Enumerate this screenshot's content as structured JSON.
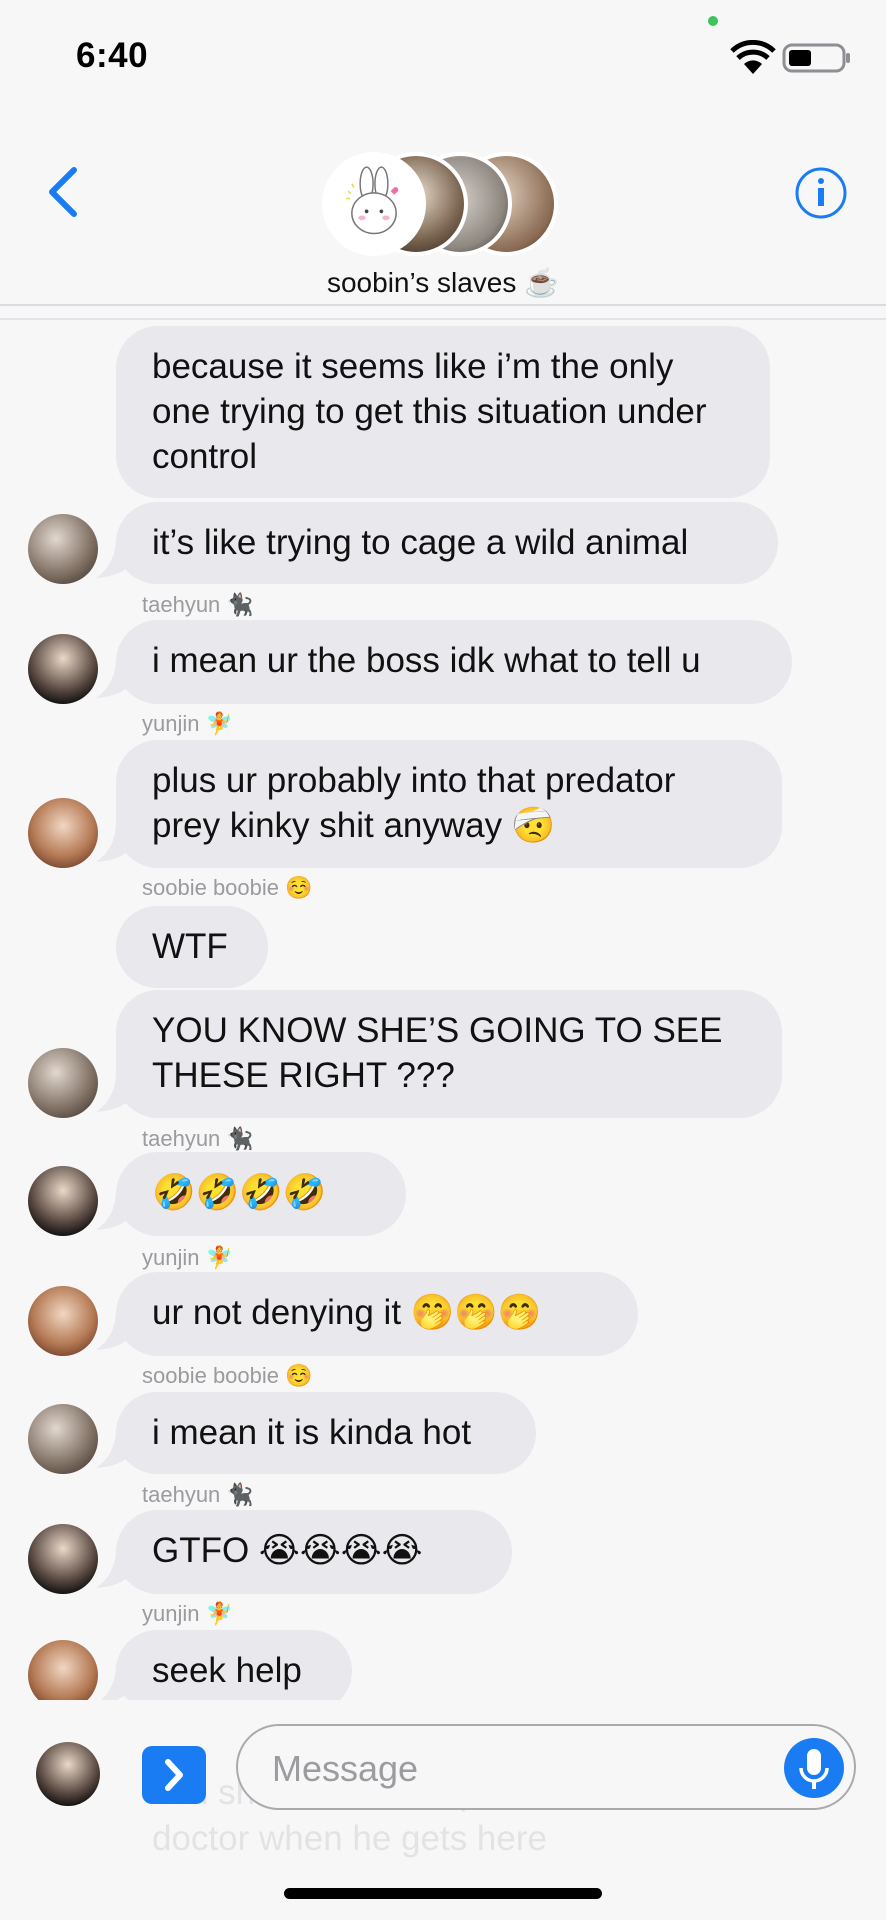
{
  "status_bar": {
    "time": "6:40"
  },
  "conversation": {
    "title": "soobin’s slaves ☕️"
  },
  "messages": [
    {
      "text": "because it seems like i’m the only one trying to get this situation under control"
    },
    {
      "text": "it’s like trying to cage a wild animal",
      "sender": "taehyun 🐈‍⬛"
    },
    {
      "text": "i mean ur the boss idk what to tell u",
      "sender": "yunjin 🧚"
    },
    {
      "text": "plus ur probably into that predator prey kinky shit anyway 🤕",
      "sender": "soobie boobie ☺️"
    },
    {
      "text": "WTF"
    },
    {
      "text": "YOU KNOW SHE’S GOING TO SEE THESE RIGHT ???",
      "sender": "taehyun 🐈‍⬛"
    },
    {
      "text": "🤣🤣🤣🤣",
      "sender": "yunjin 🧚"
    },
    {
      "text": "ur not denying it 🤭🤭🤭",
      "sender": "soobie boobie ☺️"
    },
    {
      "text": "i mean it is kinda hot",
      "sender": "taehyun 🐈‍⬛"
    },
    {
      "text": "GTFO 😭😭😭😭",
      "sender": "yunjin 🧚"
    },
    {
      "text": "seek help"
    }
  ],
  "ghost_message": "can share the zootopia erotica with the doctor when he gets here",
  "composer": {
    "placeholder": "Message"
  }
}
